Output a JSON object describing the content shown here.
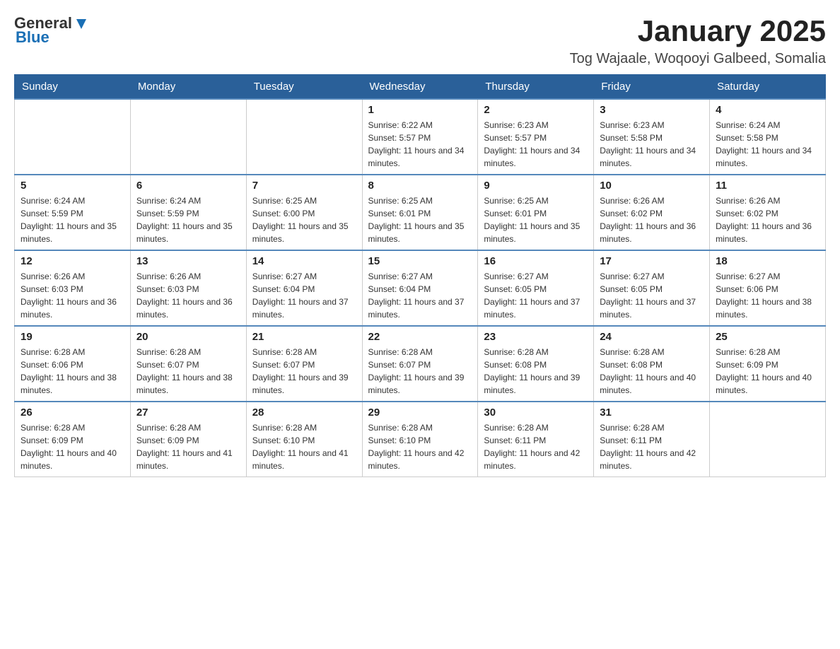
{
  "header": {
    "logo": {
      "general": "General",
      "blue": "Blue"
    },
    "title": "January 2025",
    "location": "Tog Wajaale, Woqooyi Galbeed, Somalia"
  },
  "calendar": {
    "days_of_week": [
      "Sunday",
      "Monday",
      "Tuesday",
      "Wednesday",
      "Thursday",
      "Friday",
      "Saturday"
    ],
    "weeks": [
      [
        {
          "day": "",
          "info": ""
        },
        {
          "day": "",
          "info": ""
        },
        {
          "day": "",
          "info": ""
        },
        {
          "day": "1",
          "info": "Sunrise: 6:22 AM\nSunset: 5:57 PM\nDaylight: 11 hours and 34 minutes."
        },
        {
          "day": "2",
          "info": "Sunrise: 6:23 AM\nSunset: 5:57 PM\nDaylight: 11 hours and 34 minutes."
        },
        {
          "day": "3",
          "info": "Sunrise: 6:23 AM\nSunset: 5:58 PM\nDaylight: 11 hours and 34 minutes."
        },
        {
          "day": "4",
          "info": "Sunrise: 6:24 AM\nSunset: 5:58 PM\nDaylight: 11 hours and 34 minutes."
        }
      ],
      [
        {
          "day": "5",
          "info": "Sunrise: 6:24 AM\nSunset: 5:59 PM\nDaylight: 11 hours and 35 minutes."
        },
        {
          "day": "6",
          "info": "Sunrise: 6:24 AM\nSunset: 5:59 PM\nDaylight: 11 hours and 35 minutes."
        },
        {
          "day": "7",
          "info": "Sunrise: 6:25 AM\nSunset: 6:00 PM\nDaylight: 11 hours and 35 minutes."
        },
        {
          "day": "8",
          "info": "Sunrise: 6:25 AM\nSunset: 6:01 PM\nDaylight: 11 hours and 35 minutes."
        },
        {
          "day": "9",
          "info": "Sunrise: 6:25 AM\nSunset: 6:01 PM\nDaylight: 11 hours and 35 minutes."
        },
        {
          "day": "10",
          "info": "Sunrise: 6:26 AM\nSunset: 6:02 PM\nDaylight: 11 hours and 36 minutes."
        },
        {
          "day": "11",
          "info": "Sunrise: 6:26 AM\nSunset: 6:02 PM\nDaylight: 11 hours and 36 minutes."
        }
      ],
      [
        {
          "day": "12",
          "info": "Sunrise: 6:26 AM\nSunset: 6:03 PM\nDaylight: 11 hours and 36 minutes."
        },
        {
          "day": "13",
          "info": "Sunrise: 6:26 AM\nSunset: 6:03 PM\nDaylight: 11 hours and 36 minutes."
        },
        {
          "day": "14",
          "info": "Sunrise: 6:27 AM\nSunset: 6:04 PM\nDaylight: 11 hours and 37 minutes."
        },
        {
          "day": "15",
          "info": "Sunrise: 6:27 AM\nSunset: 6:04 PM\nDaylight: 11 hours and 37 minutes."
        },
        {
          "day": "16",
          "info": "Sunrise: 6:27 AM\nSunset: 6:05 PM\nDaylight: 11 hours and 37 minutes."
        },
        {
          "day": "17",
          "info": "Sunrise: 6:27 AM\nSunset: 6:05 PM\nDaylight: 11 hours and 37 minutes."
        },
        {
          "day": "18",
          "info": "Sunrise: 6:27 AM\nSunset: 6:06 PM\nDaylight: 11 hours and 38 minutes."
        }
      ],
      [
        {
          "day": "19",
          "info": "Sunrise: 6:28 AM\nSunset: 6:06 PM\nDaylight: 11 hours and 38 minutes."
        },
        {
          "day": "20",
          "info": "Sunrise: 6:28 AM\nSunset: 6:07 PM\nDaylight: 11 hours and 38 minutes."
        },
        {
          "day": "21",
          "info": "Sunrise: 6:28 AM\nSunset: 6:07 PM\nDaylight: 11 hours and 39 minutes."
        },
        {
          "day": "22",
          "info": "Sunrise: 6:28 AM\nSunset: 6:07 PM\nDaylight: 11 hours and 39 minutes."
        },
        {
          "day": "23",
          "info": "Sunrise: 6:28 AM\nSunset: 6:08 PM\nDaylight: 11 hours and 39 minutes."
        },
        {
          "day": "24",
          "info": "Sunrise: 6:28 AM\nSunset: 6:08 PM\nDaylight: 11 hours and 40 minutes."
        },
        {
          "day": "25",
          "info": "Sunrise: 6:28 AM\nSunset: 6:09 PM\nDaylight: 11 hours and 40 minutes."
        }
      ],
      [
        {
          "day": "26",
          "info": "Sunrise: 6:28 AM\nSunset: 6:09 PM\nDaylight: 11 hours and 40 minutes."
        },
        {
          "day": "27",
          "info": "Sunrise: 6:28 AM\nSunset: 6:09 PM\nDaylight: 11 hours and 41 minutes."
        },
        {
          "day": "28",
          "info": "Sunrise: 6:28 AM\nSunset: 6:10 PM\nDaylight: 11 hours and 41 minutes."
        },
        {
          "day": "29",
          "info": "Sunrise: 6:28 AM\nSunset: 6:10 PM\nDaylight: 11 hours and 42 minutes."
        },
        {
          "day": "30",
          "info": "Sunrise: 6:28 AM\nSunset: 6:11 PM\nDaylight: 11 hours and 42 minutes."
        },
        {
          "day": "31",
          "info": "Sunrise: 6:28 AM\nSunset: 6:11 PM\nDaylight: 11 hours and 42 minutes."
        },
        {
          "day": "",
          "info": ""
        }
      ]
    ]
  }
}
